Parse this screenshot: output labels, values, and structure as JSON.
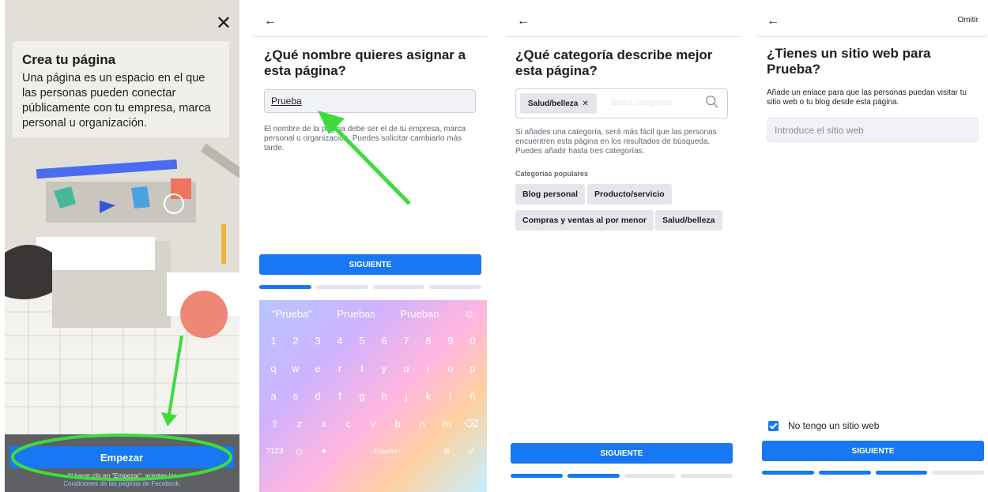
{
  "panel1": {
    "close_icon": "close-icon",
    "title": "Crea tu página",
    "body": "Una página es un espacio en el que las personas pueden conectar públicamente con tu empresa, marca personal u organización.",
    "button": "Empezar",
    "terms_prefix": "Al hacer clic en \"Empezar\", aceptas las",
    "terms_link": "Condiciones de las páginas de Facebook."
  },
  "panel2": {
    "title": "¿Qué nombre quieres asignar a esta página?",
    "input_value": "Prueba",
    "help": "El nombre de la página debe ser el de tu empresa, marca personal u organización. Puedes solicitar cambiarlo más tarde.",
    "button": "SIGUIENTE",
    "keyboard": {
      "suggestions": [
        "\"Prueba\"",
        "Pruebas",
        "Prueban"
      ],
      "numbers": [
        "1",
        "2",
        "3",
        "4",
        "5",
        "6",
        "7",
        "8",
        "9",
        "0"
      ],
      "row1": [
        "q",
        "w",
        "e",
        "r",
        "t",
        "y",
        "u",
        "i",
        "o",
        "p"
      ],
      "row2": [
        "a",
        "s",
        "d",
        "f",
        "g",
        "h",
        "j",
        "k",
        "l",
        "ñ"
      ],
      "row3": [
        "z",
        "x",
        "c",
        "v",
        "b",
        "n",
        "m"
      ],
      "sym_key": "?123",
      "space_label": "‹ Español ›"
    }
  },
  "panel3": {
    "title": "¿Qué categoría describe mejor esta página?",
    "selected_chip": "Salud/belleza",
    "search_placeholder": "Busca categorías",
    "help": "Si añades una categoría, será más fácil que las personas encuentren esta página en los resultados de búsqueda. Puedes añadir hasta tres categorías.",
    "popular_label": "Categorías populares",
    "popular": [
      "Blog personal",
      "Producto/servicio",
      "Compras y ventas al por menor",
      "Salud/belleza"
    ],
    "button": "SIGUIENTE"
  },
  "panel4": {
    "skip": "Omitir",
    "title": "¿Tienes un sitio web para Prueba?",
    "help": "Añade un enlace para que las personas puedan visitar tu sitio web o tu blog desde esta página.",
    "input_placeholder": "Introduce el sitio web",
    "checkbox_label": "No tengo un sitio web",
    "checkbox_checked": true,
    "button": "SIGUIENTE"
  },
  "colors": {
    "brand_blue": "#1877f2",
    "annotation_green": "#3ddc3d",
    "divider": "#dadde1"
  }
}
